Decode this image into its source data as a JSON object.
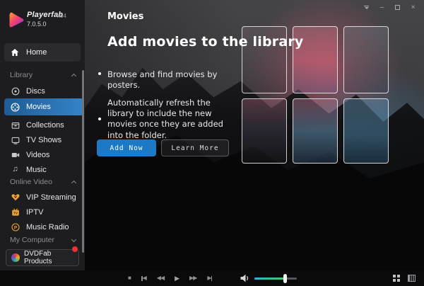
{
  "app": {
    "name": "Playerfab",
    "arch": "x64",
    "version": "7.0.5.0"
  },
  "window_controls": {
    "menu": "menu",
    "minimize": "–",
    "maximize": "maximize",
    "close": "×"
  },
  "sidebar": {
    "home": {
      "label": "Home",
      "icon": "home-icon"
    },
    "sections": [
      {
        "label": "Library",
        "chevron": "up"
      },
      {
        "label": "Online Video",
        "chevron": "up"
      },
      {
        "label": "My Computer",
        "chevron": "down"
      }
    ],
    "library_items": [
      {
        "label": "Discs",
        "icon": "disc-icon"
      },
      {
        "label": "Movies",
        "icon": "film-reel-icon",
        "selected": true
      },
      {
        "label": "Collections",
        "icon": "collections-icon"
      },
      {
        "label": "TV Shows",
        "icon": "tv-icon"
      },
      {
        "label": "Videos",
        "icon": "video-camera-icon"
      },
      {
        "label": "Music",
        "icon": "music-note-icon",
        "glyph": "♫"
      }
    ],
    "online_items": [
      {
        "label": "VIP Streaming",
        "icon": "vip-heart-icon"
      },
      {
        "label": "IPTV",
        "icon": "iptv-icon",
        "badge_text": "TV"
      },
      {
        "label": "Music Radio",
        "icon": "radio-icon",
        "glyph": "P"
      }
    ],
    "footer_button": {
      "label": "DVDFab Products",
      "icon": "dvdfab-logo-icon",
      "notification": true
    }
  },
  "main": {
    "page_title": "Movies",
    "heading": "Add movies to the library",
    "bullets": [
      "Browse and find movies by posters.",
      "Automatically refresh the library to include the new movies once they are added into the folder."
    ],
    "buttons": {
      "primary": "Add Now",
      "secondary": "Learn More"
    }
  },
  "player": {
    "transport": [
      "stop",
      "previous",
      "rewind",
      "play",
      "fast-forward",
      "next"
    ],
    "stop_glyph": "■",
    "rewind_glyph": "◀◀",
    "play_glyph": "▶",
    "forward_glyph": "▶▶",
    "prev_glyph": "◀",
    "next_glyph": "▶",
    "volume_percent": 72
  },
  "colors": {
    "accent_blue": "#1b79c5",
    "selected_gradient": [
      "#1e5c95",
      "#3583c8"
    ],
    "accent_orange": "#f0a233",
    "notification_red": "#e63333",
    "volume_gradient": [
      "#2fb3da",
      "#4bc55e"
    ],
    "sidebar_bg": "#1d1d20",
    "player_bar_bg": "#0a0a0b"
  }
}
